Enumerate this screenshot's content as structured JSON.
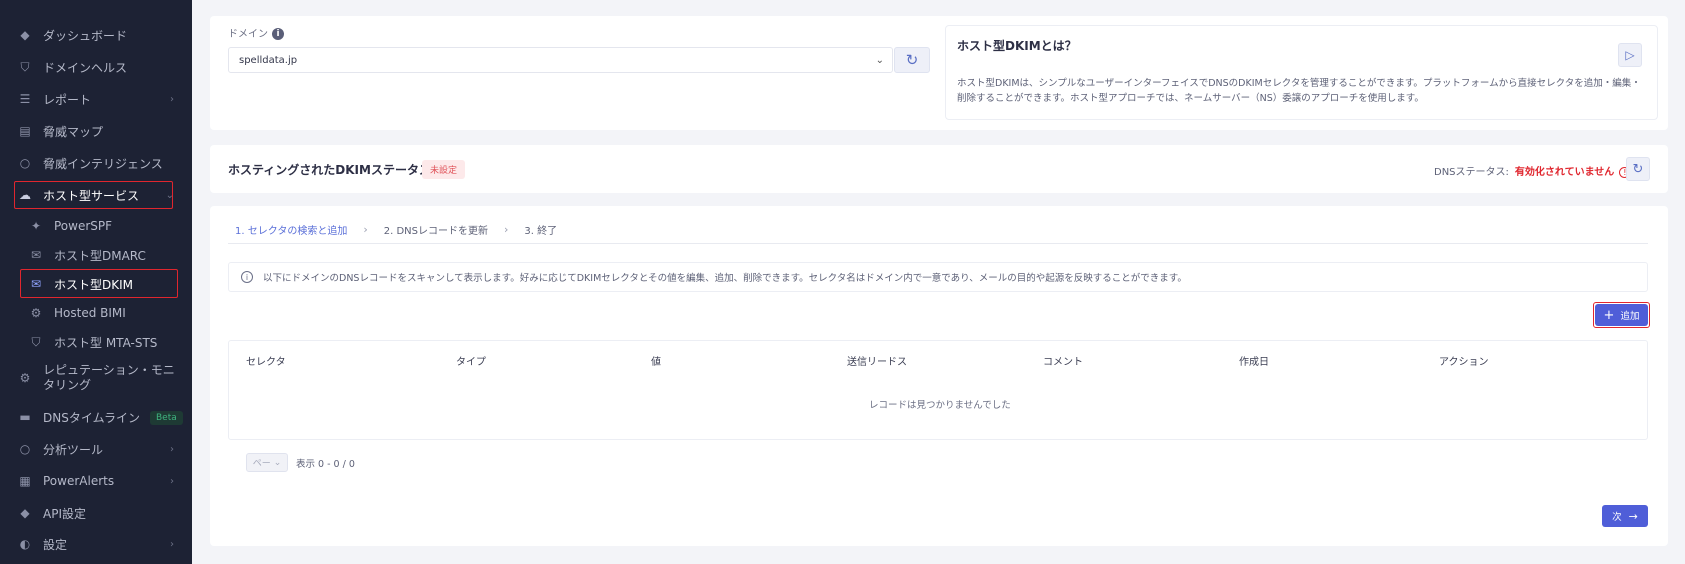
{
  "sidebar": {
    "items": [
      {
        "label": "ダッシュボード",
        "icon": "diamond-icon"
      },
      {
        "label": "ドメインヘルス",
        "icon": "shield-check-icon"
      },
      {
        "label": "レポート",
        "icon": "report-icon"
      },
      {
        "label": "脅威マップ",
        "icon": "map-icon"
      },
      {
        "label": "脅威インテリジェンス",
        "icon": "radar-icon"
      },
      {
        "label": "ホスト型サービス",
        "icon": "cloud-icon"
      },
      {
        "label": "PowerSPF",
        "icon": "spf-icon"
      },
      {
        "label": "ホスト型DMARC",
        "icon": "mail-icon"
      },
      {
        "label": "ホスト型DKIM",
        "icon": "mail-check-icon"
      },
      {
        "label": "Hosted BIMI",
        "icon": "gear-icon"
      },
      {
        "label": "ホスト型 MTA-STS",
        "icon": "shield-icon"
      },
      {
        "label": "レピュテーション・モニタリング",
        "icon": "gear-icon"
      },
      {
        "label": "DNSタイムライン",
        "icon": "timeline-icon",
        "badge": "Beta"
      },
      {
        "label": "分析ツール",
        "icon": "analysis-icon"
      },
      {
        "label": "PowerAlerts",
        "icon": "alerts-icon"
      },
      {
        "label": "API設定",
        "icon": "api-icon"
      },
      {
        "label": "設定",
        "icon": "toggle-icon"
      }
    ]
  },
  "domain": {
    "label": "ドメイン",
    "value": "spelldata.jp"
  },
  "info": {
    "title": "ホスト型DKIMとは？",
    "text": "ホスト型DKIMは、シンプルなユーザーインターフェイスでDNSのDKIMセレクタを管理することができます。プラットフォームから直接セレクタを追加・編集・削除することができます。ホスト型アプローチでは、ネームサーバー（NS）委譲のアプローチを使用します。"
  },
  "status": {
    "title": "ホスティングされたDKIMステータス",
    "badge": "未設定",
    "dns_label": "DNSステータス:",
    "dns_value": "有効化されていません"
  },
  "steps": [
    "1. セレクタの検索と追加",
    "2. DNSレコードを更新",
    "3. 終了"
  ],
  "notice": "以下にドメインのDNSレコードをスキャンして表示します。好みに応じてDKIMセレクタとその値を編集、追加、削除できます。セレクタ名はドメイン内で一意であり、メールの目的や起源を反映することができます。",
  "add_button": "追加",
  "table": {
    "headers": [
      "セレクタ",
      "タイプ",
      "値",
      "送信リードス",
      "コメント",
      "作成日",
      "アクション"
    ],
    "empty": "レコードは見つかりませんでした"
  },
  "pager": {
    "select_placeholder": "ペー",
    "summary": "表示 0 - 0 / 0"
  },
  "next_button": "次"
}
